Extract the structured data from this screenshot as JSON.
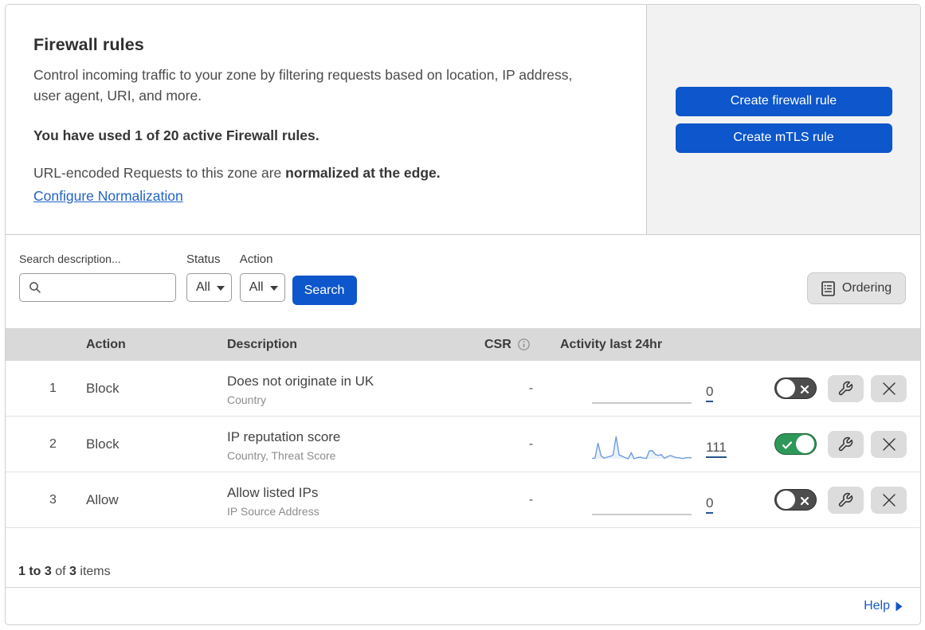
{
  "colors": {
    "primary_blue": "#0d56cb",
    "link_blue": "#2263c5",
    "toggle_on_green": "#2e9858",
    "toggle_off_gray": "#4d4d4d",
    "table_header_gray": "#d9d9d9",
    "panel_gray": "#f2f2f2",
    "sparkline_blue": "#6f9ce0"
  },
  "header": {
    "title": "Firewall rules",
    "description": "Control incoming traffic to your zone by filtering requests based on location, IP address, user agent, URI, and more.",
    "usage": "You have used 1 of 20 active Firewall rules.",
    "normalization_prefix": "URL-encoded Requests to this zone are ",
    "normalization_bold": "normalized at the edge.",
    "normalization_link": "Configure Normalization",
    "create_firewall_label": "Create firewall rule",
    "create_mtls_label": "Create mTLS rule"
  },
  "filters": {
    "search_label": "Search description...",
    "search_value": "",
    "status_label": "Status",
    "status_value": "All",
    "action_label": "Action",
    "action_value": "All",
    "search_button": "Search",
    "ordering_button": "Ordering"
  },
  "table": {
    "columns": {
      "action": "Action",
      "description": "Description",
      "csr": "CSR",
      "activity": "Activity last 24hr"
    },
    "rows": [
      {
        "num": "1",
        "action": "Block",
        "description": "Does not originate in UK",
        "fields": "Country",
        "csr": "-",
        "activity_count": "0",
        "enabled": false,
        "sparkline": [
          0,
          0,
          0,
          0,
          0,
          0,
          0,
          0,
          0,
          0,
          0,
          0,
          0,
          0,
          0,
          0,
          0,
          0,
          0,
          0,
          0,
          0,
          0,
          0,
          0,
          0,
          0,
          0,
          0,
          0,
          0,
          0,
          0,
          0
        ]
      },
      {
        "num": "2",
        "action": "Block",
        "description": "IP reputation score",
        "fields": "Country, Threat Score",
        "csr": "-",
        "activity_count": "111",
        "enabled": true,
        "sparkline": [
          1,
          3,
          68,
          13,
          2,
          7,
          10,
          16,
          97,
          16,
          11,
          5,
          0,
          26,
          0,
          5,
          7,
          3,
          1,
          34,
          35,
          19,
          14,
          18,
          2,
          9,
          14,
          9,
          5,
          4,
          1,
          4,
          5,
          5
        ]
      },
      {
        "num": "3",
        "action": "Allow",
        "description": "Allow listed IPs",
        "fields": "IP Source Address",
        "csr": "-",
        "activity_count": "0",
        "enabled": false,
        "sparkline": [
          0,
          0,
          0,
          0,
          0,
          0,
          0,
          0,
          0,
          0,
          0,
          0,
          0,
          0,
          0,
          0,
          0,
          0,
          0,
          0,
          0,
          0,
          0,
          0,
          0,
          0,
          0,
          0,
          0,
          0,
          0,
          0,
          0,
          0
        ]
      }
    ],
    "footer": {
      "range": "1 to 3",
      "of": "of",
      "total": "3",
      "items": "items"
    }
  },
  "help": {
    "label": "Help"
  }
}
